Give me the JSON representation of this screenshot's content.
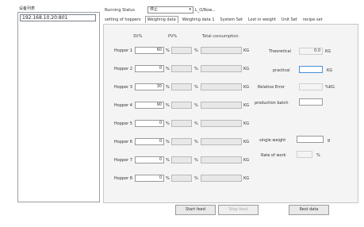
{
  "device": {
    "title": "设备列表",
    "items": [
      {
        "label": "192.168.10.20:801"
      }
    ]
  },
  "status": {
    "label": "Running Status",
    "select_value": "停止",
    "value_text": "L_O/Row..."
  },
  "tabs": [
    {
      "label": "setting of hoppers",
      "active": false
    },
    {
      "label": "Weighing data",
      "active": true
    },
    {
      "label": "Weighing data 1",
      "active": false
    },
    {
      "label": "System Set",
      "active": false
    },
    {
      "label": "Lost in weight",
      "active": false
    },
    {
      "label": "Unit Set",
      "active": false
    },
    {
      "label": "recipe set",
      "active": false
    }
  ],
  "table": {
    "headers": {
      "sv": "SV%",
      "pv": "PV%",
      "total": "Total consumption"
    },
    "hopper_unit": "%",
    "total_unit": "KG",
    "rows": [
      {
        "label": "Hopper 1",
        "sv": "60"
      },
      {
        "label": "Hopper 2",
        "sv": "0"
      },
      {
        "label": "Hopper 3",
        "sv": "30"
      },
      {
        "label": "Hopper 4",
        "sv": "90"
      },
      {
        "label": "Hopper 5",
        "sv": "0"
      },
      {
        "label": "Hopper 6",
        "sv": "0"
      },
      {
        "label": "Hopper 7",
        "sv": "0"
      },
      {
        "label": "Hopper 8",
        "sv": "0"
      }
    ]
  },
  "right": {
    "theoretical_label": "Theoretical",
    "theoretical_value": "0.0",
    "theoretical_unit": "KG",
    "practical_label": "practical",
    "practical_unit": "KG",
    "error_label": "Relative Error",
    "error_unit": "%KG",
    "batch_label": "production batch",
    "single_weight_label": "single weight",
    "single_weight_unit": "g",
    "rate_label": "Rate of work",
    "rate_unit": "%"
  },
  "buttons": {
    "start": "Start feed",
    "stop": "Stop feed",
    "reset": "Rest data"
  }
}
